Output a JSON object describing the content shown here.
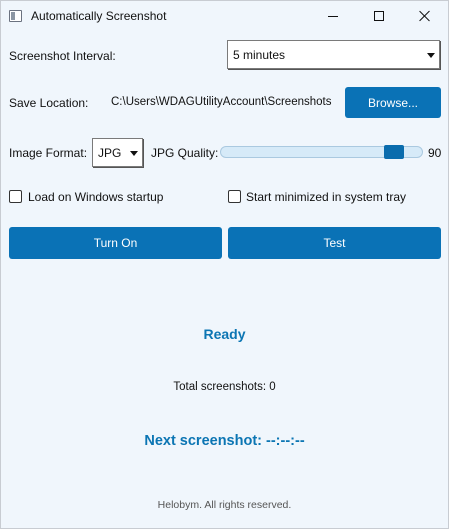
{
  "window": {
    "title": "Automatically Screenshot"
  },
  "interval": {
    "label": "Screenshot Interval:",
    "selected": "5 minutes"
  },
  "save": {
    "label": "Save Location:",
    "path": "C:\\Users\\WDAGUtilityAccount\\Screenshots",
    "browse_label": "Browse..."
  },
  "format": {
    "label": "Image Format:",
    "selected": "JPG",
    "quality_label": "JPG Quality:",
    "quality_value": "90",
    "quality_max": 100
  },
  "options": {
    "startup_label": "Load on Windows startup",
    "startup_checked": false,
    "tray_label": "Start minimized in system tray",
    "tray_checked": false
  },
  "actions": {
    "turn_on_label": "Turn On",
    "test_label": "Test"
  },
  "status": {
    "state": "Ready",
    "total": "Total screenshots: 0",
    "next": "Next screenshot: --:--:--"
  },
  "footer": {
    "text": "Helobym. All rights reserved."
  },
  "colors": {
    "accent": "#0a72b6",
    "status_text": "#0b75b3",
    "background": "#f0f6fc"
  },
  "icons": {
    "app": "app-window-icon",
    "minimize": "minimize-icon",
    "maximize": "maximize-icon",
    "close": "close-icon",
    "dropdown": "chevron-down-icon"
  }
}
